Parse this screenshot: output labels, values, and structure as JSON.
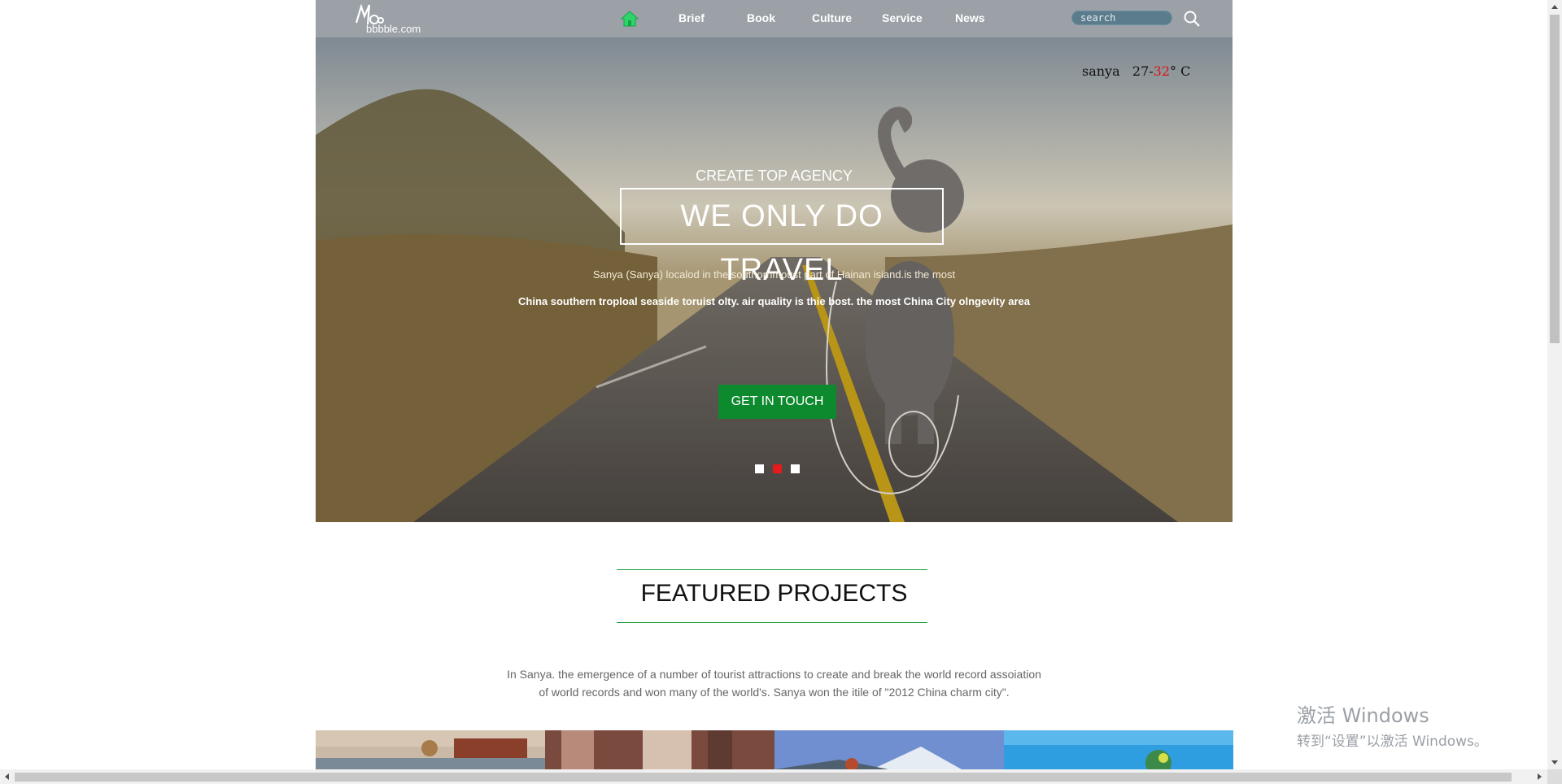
{
  "brand": {
    "logo_text": "bbbble.com"
  },
  "nav": {
    "items": [
      {
        "label": "Brief"
      },
      {
        "label": "Book"
      },
      {
        "label": "Culture"
      },
      {
        "label": "Service"
      },
      {
        "label": "News"
      }
    ],
    "home_icon": "home-icon",
    "search_placeholder": "search",
    "search_icon": "search-icon"
  },
  "weather": {
    "city": "sanya",
    "low": "27",
    "sep": "-",
    "high": "32",
    "unit": "° C"
  },
  "hero": {
    "subtitle": "CREATE TOP AGENCY",
    "title": "WE ONLY DO TRAVEL",
    "line1": "Sanya (Sanya) localod in the southornmoust part of Hainan isiand.is the most",
    "line2": "China southern troploal seaside toruist olty. air quality is thie bost. the most China City olngevity area",
    "cta": "GET IN TOUCH",
    "slides": 3,
    "active_slide": 2
  },
  "featured": {
    "title": "FEATURED PROJECTS",
    "desc_line1": "In Sanya. the emergence of a number of tourist attractions to create and break the world record assoiation",
    "desc_line2": "of world records and won many of the world's. Sanya won the itile of \"2012 China charm city\"."
  },
  "watermark": {
    "line1": "激活 Windows",
    "line2": "转到“设置”以激活 Windows。"
  },
  "colors": {
    "accent_green": "#0e8a2e",
    "rule_green": "#1b9c3a",
    "active_dot": "#e31b1b",
    "header_bg": "#969ca2"
  }
}
